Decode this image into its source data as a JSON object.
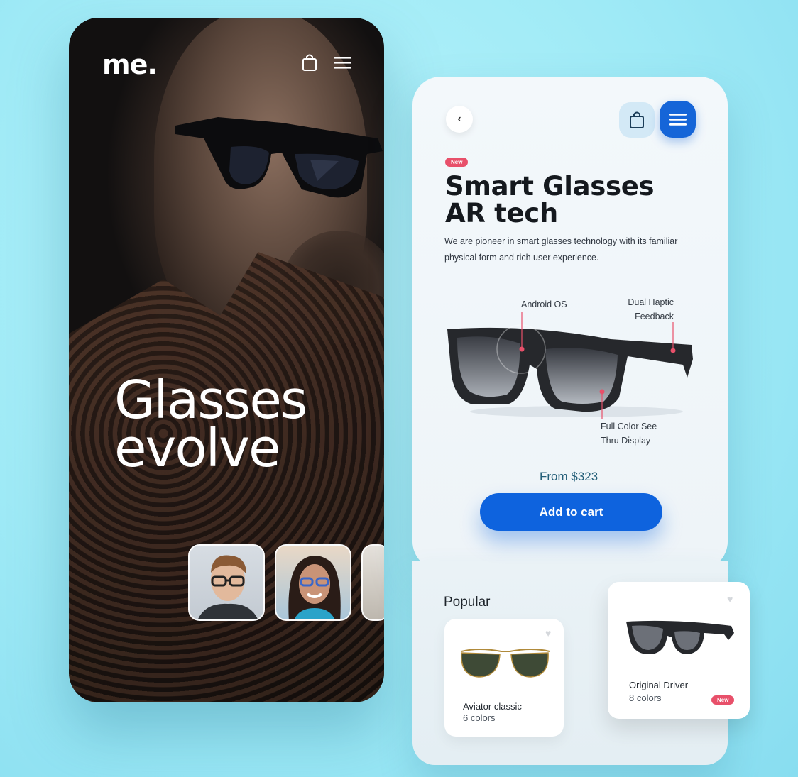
{
  "left_screen": {
    "brand": "me.",
    "hero_title_line1": "Glasses",
    "hero_title_line2": "evolve",
    "icons": [
      "shopping-bag-icon",
      "menu-icon"
    ]
  },
  "detail": {
    "badge": "New",
    "title_line1": "Smart Glasses",
    "title_line2": "AR tech",
    "description": "We are pioneer in smart glasses technology with its familiar physical form and rich user experience.",
    "features": {
      "android": "Android OS",
      "haptic_line1": "Dual Haptic",
      "haptic_line2": "Feedback",
      "display_line1": "Full Color See",
      "display_line2": "Thru Display"
    },
    "price": "From $323",
    "cta": "Add to cart",
    "colors": {
      "accent": "#0e63de",
      "badge": "#e8506a"
    }
  },
  "popular": {
    "title": "Popular",
    "items": [
      {
        "name": "Aviator classic",
        "colors": "6 colors",
        "badge": ""
      },
      {
        "name": "Original Driver",
        "colors": "8 colors",
        "badge": "New"
      }
    ]
  }
}
